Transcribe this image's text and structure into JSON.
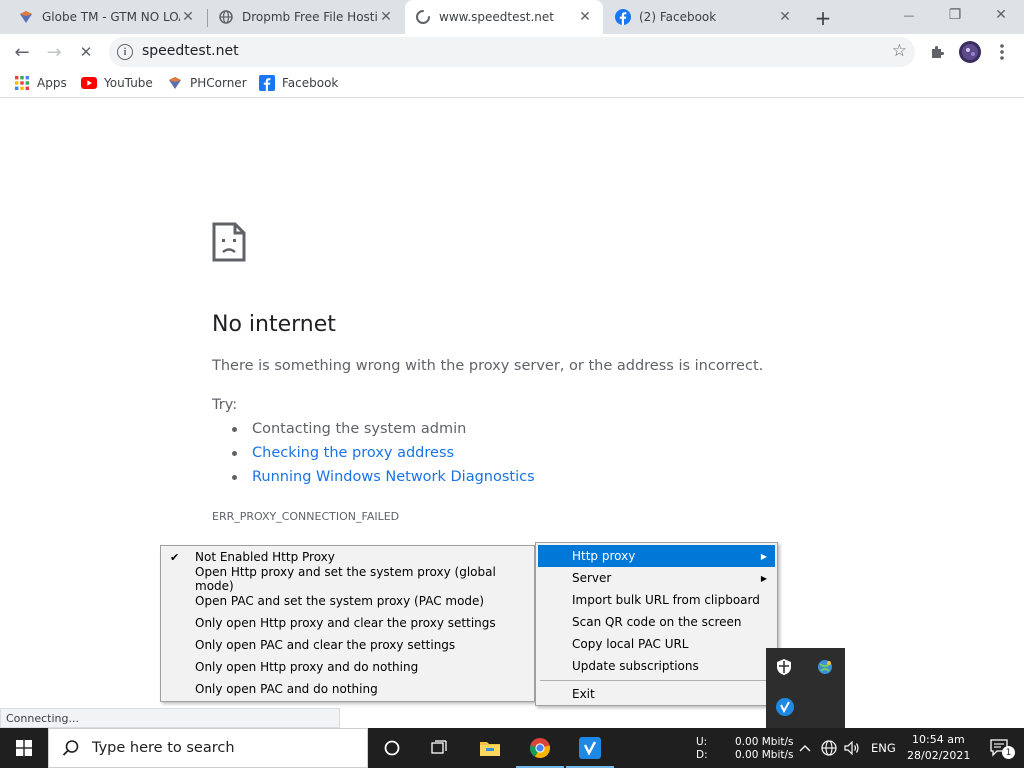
{
  "tabs": [
    {
      "title": "Globe TM - GTM NO LOAD",
      "icon": "phcorner-icon"
    },
    {
      "title": "Dropmb Free File Hosting",
      "icon": "globe-icon"
    },
    {
      "title": "www.speedtest.net",
      "icon": "loading-spinner-icon"
    },
    {
      "title": "(2) Facebook",
      "icon": "facebook-icon"
    }
  ],
  "tab_close_glyph": "✕",
  "new_tab_glyph": "+",
  "window_controls": {
    "minimize": "—",
    "restore": "❐",
    "close": "✕"
  },
  "toolbar": {
    "back": "←",
    "forward": "→",
    "stop": "✕",
    "url": "speedtest.net",
    "info": "i",
    "star": "☆"
  },
  "bookmarks": [
    {
      "label": "Apps",
      "icon": "apps-grid-icon"
    },
    {
      "label": "YouTube",
      "icon": "youtube-icon"
    },
    {
      "label": "PHCorner",
      "icon": "phcorner-icon"
    },
    {
      "label": "Facebook",
      "icon": "facebook-icon"
    }
  ],
  "error_page": {
    "title": "No internet",
    "description": "There is something wrong with the proxy server, or the address is incorrect.",
    "try_label": "Try:",
    "suggestions": [
      {
        "text": "Contacting the system admin",
        "link": false
      },
      {
        "text": "Checking the proxy address",
        "link": true
      },
      {
        "text": "Running Windows Network Diagnostics",
        "link": true
      }
    ],
    "error_code": "ERR_PROXY_CONNECTION_FAILED"
  },
  "proxy_submenu": {
    "items": [
      {
        "label": "Not Enabled Http Proxy",
        "checked": true
      },
      {
        "label": "Open Http proxy and set the system proxy (global mode)",
        "checked": false
      },
      {
        "label": "Open PAC and set the system proxy (PAC mode)",
        "checked": false
      },
      {
        "label": "Only open Http proxy and clear the proxy settings",
        "checked": false
      },
      {
        "label": "Only open PAC and clear the proxy settings",
        "checked": false
      },
      {
        "label": "Only open Http proxy and do nothing",
        "checked": false
      },
      {
        "label": "Only open PAC and do nothing",
        "checked": false
      }
    ],
    "check_glyph": "✔"
  },
  "tray_menu": {
    "items": [
      {
        "label": "Http proxy",
        "submenu": true,
        "highlighted": true
      },
      {
        "label": "Server",
        "submenu": true,
        "highlighted": false
      },
      {
        "label": "Import bulk URL from clipboard",
        "submenu": false,
        "highlighted": false
      },
      {
        "label": "Scan QR code on the screen",
        "submenu": false,
        "highlighted": false
      },
      {
        "label": "Copy local PAC URL",
        "submenu": false,
        "highlighted": false
      },
      {
        "label": "Update subscriptions",
        "submenu": false,
        "highlighted": false
      }
    ],
    "exit_label": "Exit",
    "submenu_glyph": "▶"
  },
  "status_bubble": "Connecting...",
  "taskbar": {
    "search_placeholder": "Type here to search",
    "net_up_label": "U:",
    "net_down_label": "D:",
    "net_up_value": "0.00 Mbit/s",
    "net_down_value": "0.00 Mbit/s",
    "language": "ENG",
    "time": "10:54 am",
    "date": "28/02/2021",
    "notification_count": "1",
    "chevron": "^"
  },
  "colors": {
    "tab_strip": "#dee1e6",
    "link": "#1a73e8",
    "menu_highlight": "#0078d7",
    "taskbar": "#1f1f1f",
    "v2ray_blue": "#1e88e5"
  }
}
